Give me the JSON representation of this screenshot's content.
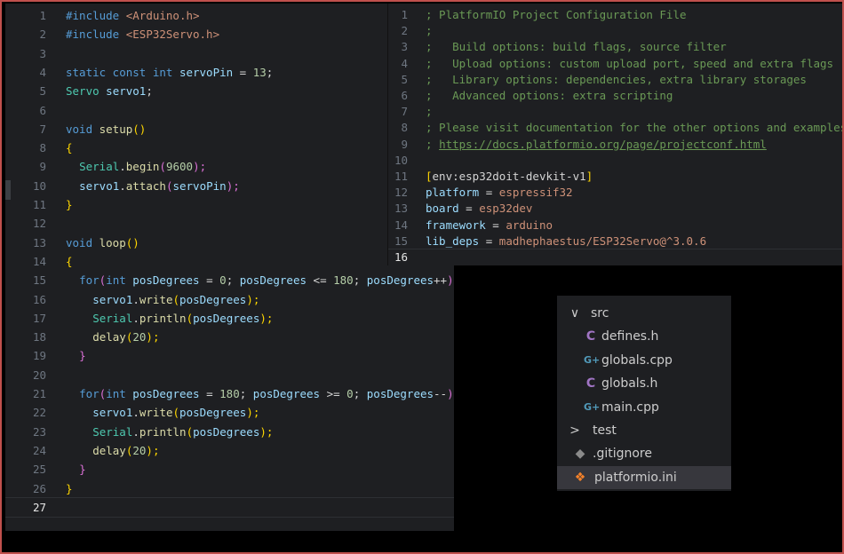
{
  "left_editor": {
    "lines": [
      {
        "n": "1"
      },
      {
        "n": "2"
      },
      {
        "n": "3"
      },
      {
        "n": "4"
      },
      {
        "n": "5"
      },
      {
        "n": "6"
      },
      {
        "n": "7"
      },
      {
        "n": "8"
      },
      {
        "n": "9"
      },
      {
        "n": "10"
      },
      {
        "n": "11"
      },
      {
        "n": "12"
      },
      {
        "n": "13"
      },
      {
        "n": "14"
      },
      {
        "n": "15"
      },
      {
        "n": "16"
      },
      {
        "n": "17"
      },
      {
        "n": "18"
      },
      {
        "n": "19"
      },
      {
        "n": "20"
      },
      {
        "n": "21"
      },
      {
        "n": "22"
      },
      {
        "n": "23"
      },
      {
        "n": "24"
      },
      {
        "n": "25"
      },
      {
        "n": "26"
      },
      {
        "n": "27"
      }
    ],
    "tokens": {
      "l1_a": "#include",
      "l1_b": " <Arduino.h>",
      "l2_a": "#include",
      "l2_b": " <ESP32Servo.h>",
      "l4_a": "static const int",
      "l4_b": " servoPin",
      "l4_c": " = ",
      "l4_d": "13",
      "l4_e": ";",
      "l5_a": "Servo",
      "l5_b": " servo1",
      "l5_c": ";",
      "l7_a": "void",
      "l7_b": " setup",
      "l7_c": "()",
      "l8_a": "{",
      "l9_a": "Serial",
      "l9_b": ".",
      "l9_c": "begin",
      "l9_d": "(",
      "l9_e": "9600",
      "l9_f": ");",
      "l10_a": "servo1",
      "l10_b": ".",
      "l10_c": "attach",
      "l10_d": "(",
      "l10_e": "servoPin",
      "l10_f": ");",
      "l11_a": "}",
      "l13_a": "void",
      "l13_b": " loop",
      "l13_c": "()",
      "l14_a": "{",
      "l15_a": "for",
      "l15_b": "(",
      "l15_c": "int",
      "l15_d": " posDegrees",
      "l15_e": " = ",
      "l15_f": "0",
      "l15_g": "; ",
      "l15_h": "posDegrees",
      "l15_i": " <= ",
      "l15_j": "180",
      "l15_k": "; ",
      "l15_l": "posDegrees",
      "l15_m": "++",
      "l15_n": ") ",
      "l15_o": "{",
      "l16_a": "servo1",
      "l16_b": ".",
      "l16_c": "write",
      "l16_d": "(",
      "l16_e": "posDegrees",
      "l16_f": ");",
      "l17_a": "Serial",
      "l17_b": ".",
      "l17_c": "println",
      "l17_d": "(",
      "l17_e": "posDegrees",
      "l17_f": ");",
      "l18_a": "delay",
      "l18_b": "(",
      "l18_c": "20",
      "l18_d": ");",
      "l19_a": "}",
      "l21_a": "for",
      "l21_b": "(",
      "l21_c": "int",
      "l21_d": " posDegrees",
      "l21_e": " = ",
      "l21_f": "180",
      "l21_g": "; ",
      "l21_h": "posDegrees",
      "l21_i": " >= ",
      "l21_j": "0",
      "l21_k": "; ",
      "l21_l": "posDegrees",
      "l21_m": "--",
      "l21_n": ") ",
      "l21_o": "{",
      "l22_a": "servo1",
      "l22_b": ".",
      "l22_c": "write",
      "l22_d": "(",
      "l22_e": "posDegrees",
      "l22_f": ");",
      "l23_a": "Serial",
      "l23_b": ".",
      "l23_c": "println",
      "l23_d": "(",
      "l23_e": "posDegrees",
      "l23_f": ");",
      "l24_a": "delay",
      "l24_b": "(",
      "l24_c": "20",
      "l24_d": ");",
      "l25_a": "}",
      "l26_a": "}"
    }
  },
  "right_editor": {
    "lines": [
      {
        "n": "1"
      },
      {
        "n": "2"
      },
      {
        "n": "3"
      },
      {
        "n": "4"
      },
      {
        "n": "5"
      },
      {
        "n": "6"
      },
      {
        "n": "7"
      },
      {
        "n": "8"
      },
      {
        "n": "9"
      },
      {
        "n": "10"
      },
      {
        "n": "11"
      },
      {
        "n": "12"
      },
      {
        "n": "13"
      },
      {
        "n": "14"
      },
      {
        "n": "15"
      },
      {
        "n": "16"
      }
    ],
    "text": {
      "r1": "; PlatformIO Project Configuration File",
      "r2": ";",
      "r3": ";   Build options: build flags, source filter",
      "r4": ";   Upload options: custom upload port, speed and extra flags",
      "r5": ";   Library options: dependencies, extra library storages",
      "r6": ";   Advanced options: extra scripting",
      "r7": ";",
      "r8": "; Please visit documentation for the other options and examples",
      "r9a": "; ",
      "r9b": "https://docs.platformio.org/page/projectconf.html",
      "r11a": "[",
      "r11b": "env:esp32doit-devkit-v1",
      "r11c": "]",
      "r12a": "platform",
      "r12b": " = ",
      "r12c": "espressif32",
      "r13a": "board",
      "r13b": " = ",
      "r13c": "esp32dev",
      "r14a": "framework",
      "r14b": " = ",
      "r14c": "arduino",
      "r15a": "lib_deps",
      "r15b": " = ",
      "r15c": "madhephaestus/ESP32Servo@^3.0.6"
    }
  },
  "explorer": {
    "items": [
      {
        "label": "src",
        "icon": "chevron-down-icon",
        "glyph": "∨"
      },
      {
        "label": "defines.h",
        "icon": "c-header-icon",
        "glyph": "C"
      },
      {
        "label": "globals.cpp",
        "icon": "cpp-file-icon",
        "glyph": "G+"
      },
      {
        "label": "globals.h",
        "icon": "c-header-icon",
        "glyph": "C"
      },
      {
        "label": "main.cpp",
        "icon": "cpp-file-icon",
        "glyph": "G+"
      },
      {
        "label": "test",
        "icon": "chevron-right-icon",
        "glyph": ">"
      },
      {
        "label": ".gitignore",
        "icon": "git-icon",
        "glyph": "◆"
      },
      {
        "label": "platformio.ini",
        "icon": "platformio-icon",
        "glyph": "❖"
      }
    ]
  },
  "colors": {
    "editor_bg": "#1e1f22",
    "frame_border": "#c0504d",
    "comment": "#6a9955",
    "keyword": "#569cd6"
  }
}
